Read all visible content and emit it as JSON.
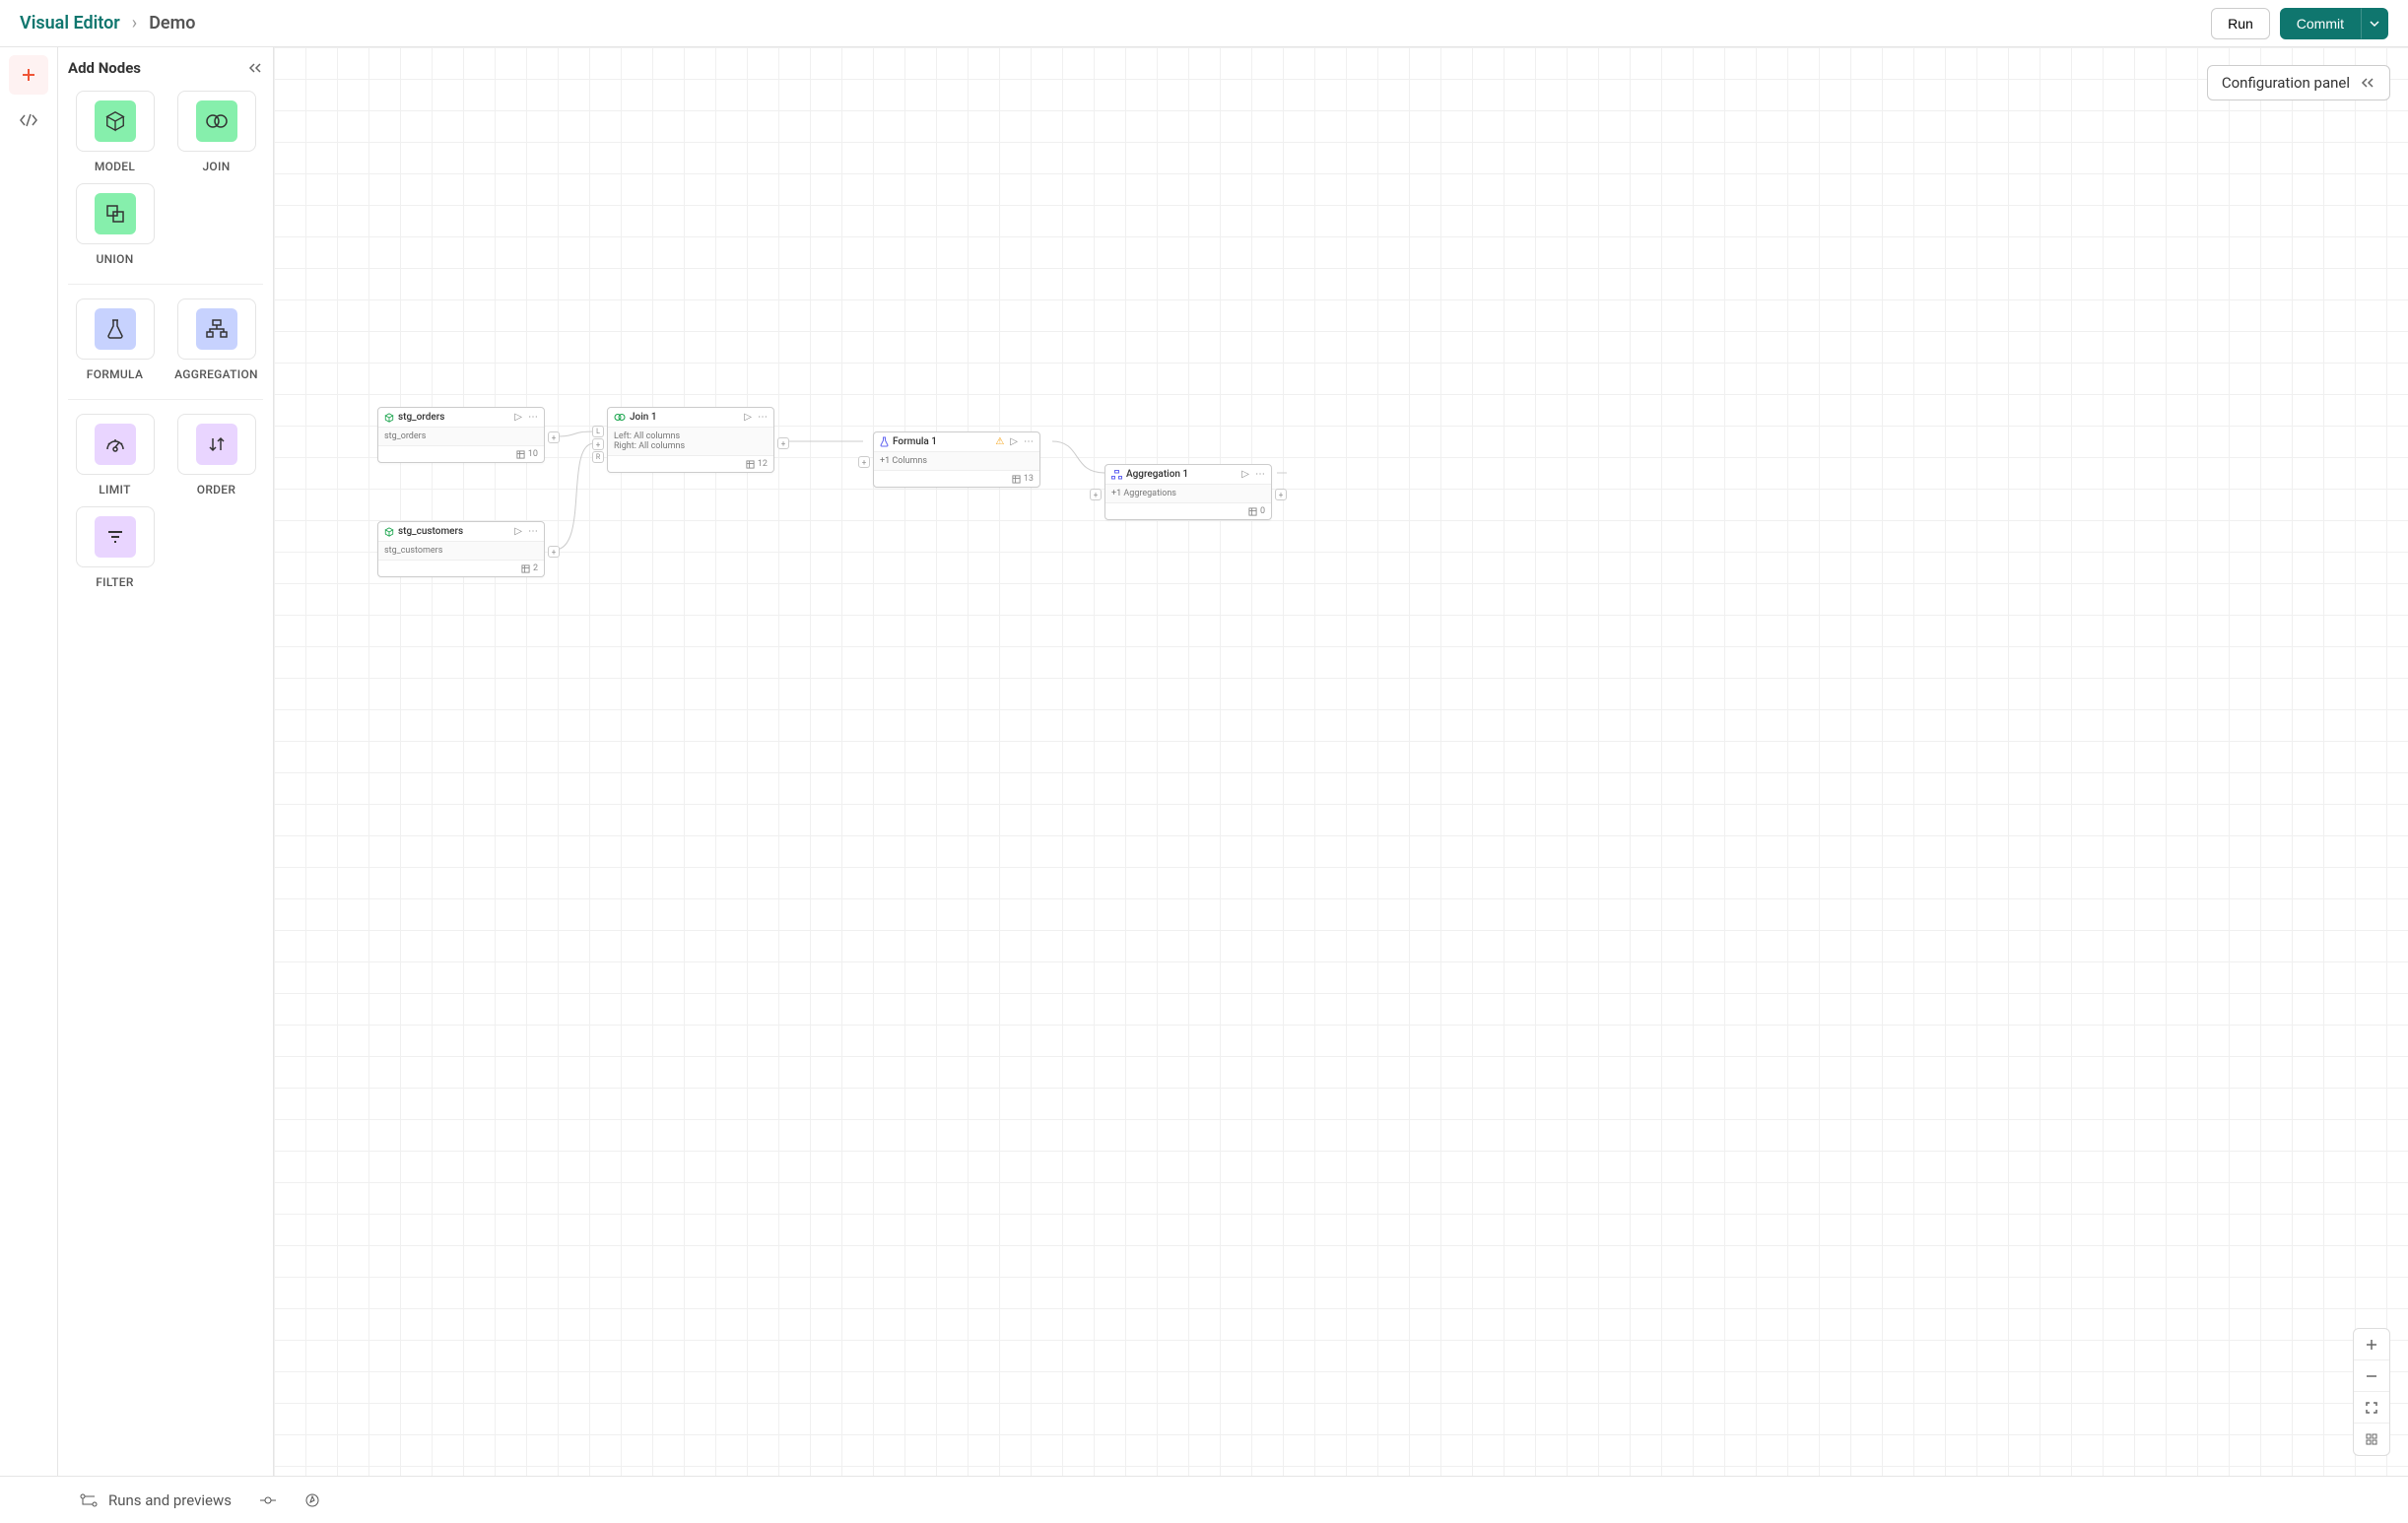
{
  "header": {
    "breadcrumb": {
      "root": "Visual Editor",
      "current": "Demo"
    },
    "run_label": "Run",
    "commit_label": "Commit"
  },
  "sidebar": {
    "title": "Add Nodes",
    "groups": [
      {
        "items": [
          {
            "id": "model",
            "label": "MODEL",
            "color": "green"
          },
          {
            "id": "join",
            "label": "JOIN",
            "color": "green"
          },
          {
            "id": "union",
            "label": "UNION",
            "color": "green"
          }
        ]
      },
      {
        "items": [
          {
            "id": "formula",
            "label": "FORMULA",
            "color": "blue"
          },
          {
            "id": "aggregation",
            "label": "AGGREGATION",
            "color": "blue"
          }
        ]
      },
      {
        "items": [
          {
            "id": "limit",
            "label": "LIMIT",
            "color": "purple"
          },
          {
            "id": "order",
            "label": "ORDER",
            "color": "purple"
          },
          {
            "id": "filter",
            "label": "FILTER",
            "color": "purple"
          }
        ]
      }
    ]
  },
  "canvas": {
    "config_panel_label": "Configuration panel",
    "nodes": {
      "stg_orders": {
        "title": "stg_orders",
        "body": "stg_orders",
        "count": "10",
        "type": "model"
      },
      "stg_customers": {
        "title": "stg_customers",
        "body": "stg_customers",
        "count": "2",
        "type": "model"
      },
      "join1": {
        "title": "Join 1",
        "body_left": "Left: All columns",
        "body_right": "Right: All columns",
        "count": "12",
        "type": "join"
      },
      "formula1": {
        "title": "Formula 1",
        "body": "+1 Columns",
        "count": "13",
        "type": "formula",
        "warning": true
      },
      "agg1": {
        "title": "Aggregation 1",
        "body": "+1 Aggregations",
        "count": "0",
        "type": "aggregation"
      }
    }
  },
  "footer": {
    "runs_label": "Runs and previews"
  }
}
